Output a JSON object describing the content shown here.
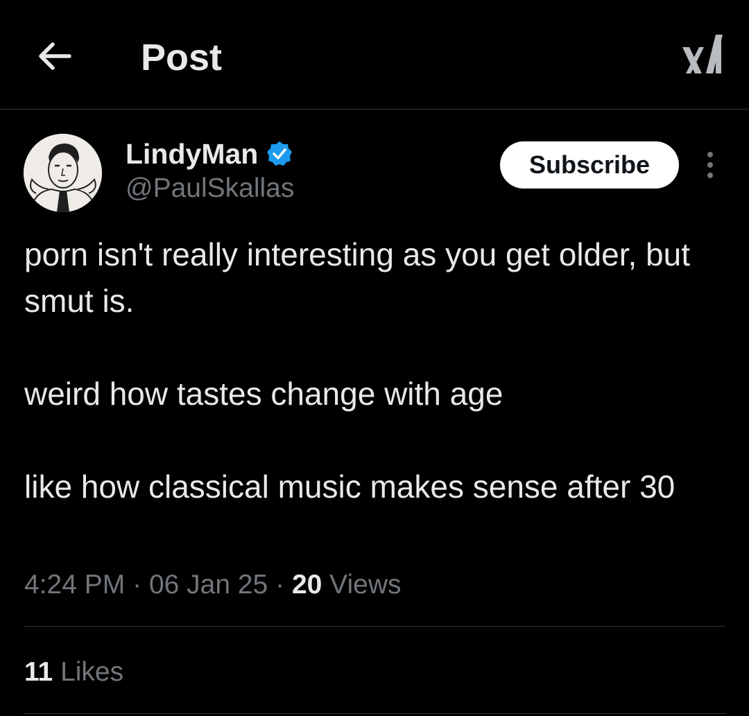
{
  "header": {
    "title": "Post",
    "back_icon": "arrow-left-icon",
    "logo_icon": "x-logo-icon"
  },
  "post": {
    "author": {
      "display_name": "LindyMan",
      "handle": "@PaulSkallas",
      "verified": true,
      "verified_color": "#1d9bf0"
    },
    "subscribe_label": "Subscribe",
    "more_icon": "more-vertical-icon",
    "text_lines": [
      "porn isn't really interesting as you get older, but smut is.",
      "weird how tastes change with age",
      "like how classical music makes sense after 30"
    ],
    "time": "4:24 PM",
    "separator": "·",
    "date": "06 Jan 25",
    "views_count": "20",
    "views_label": "Views",
    "likes_count": "11",
    "likes_label": "Likes"
  },
  "colors": {
    "background": "#000000",
    "primary_text": "#e7e9ea",
    "secondary_text": "#71767b",
    "divider": "#2f3336",
    "button_bg": "#ffffff"
  }
}
